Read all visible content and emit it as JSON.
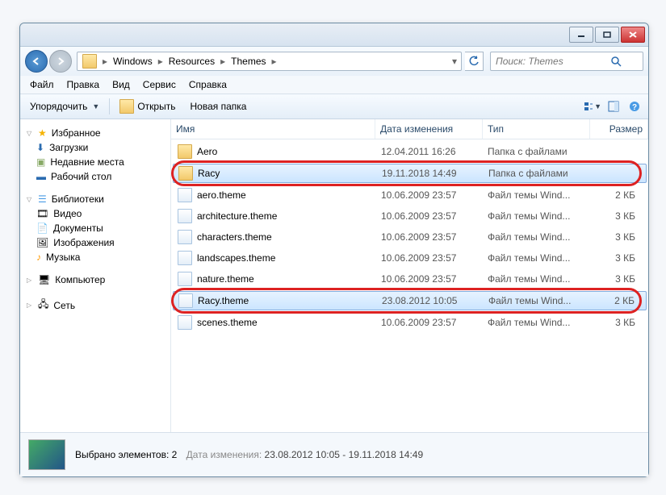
{
  "breadcrumb": {
    "p1": "Windows",
    "p2": "Resources",
    "p3": "Themes"
  },
  "search": {
    "placeholder": "Поиск: Themes"
  },
  "menu": {
    "file": "Файл",
    "edit": "Правка",
    "view": "Вид",
    "tools": "Сервис",
    "help": "Справка"
  },
  "toolbar": {
    "organize": "Упорядочить",
    "open": "Открыть",
    "newfolder": "Новая папка"
  },
  "columns": {
    "name": "Имя",
    "date": "Дата изменения",
    "type": "Тип",
    "size": "Размер"
  },
  "sidebar": {
    "favorites": {
      "label": "Избранное",
      "items": {
        "downloads": "Загрузки",
        "recent": "Недавние места",
        "desktop": "Рабочий стол"
      }
    },
    "libraries": {
      "label": "Библиотеки",
      "items": {
        "video": "Видео",
        "documents": "Документы",
        "images": "Изображения",
        "music": "Музыка"
      }
    },
    "computer": {
      "label": "Компьютер"
    },
    "network": {
      "label": "Сеть"
    }
  },
  "files": [
    {
      "name": "Aero",
      "date": "12.04.2011 16:26",
      "type": "Папка с файлами",
      "size": "",
      "icon": "folder",
      "sel": false,
      "hl": false
    },
    {
      "name": "Racy",
      "date": "19.11.2018 14:49",
      "type": "Папка с файлами",
      "size": "",
      "icon": "folder",
      "sel": true,
      "hl": true
    },
    {
      "name": "aero.theme",
      "date": "10.06.2009 23:57",
      "type": "Файл темы Wind...",
      "size": "2 КБ",
      "icon": "file",
      "sel": false,
      "hl": false
    },
    {
      "name": "architecture.theme",
      "date": "10.06.2009 23:57",
      "type": "Файл темы Wind...",
      "size": "3 КБ",
      "icon": "file",
      "sel": false,
      "hl": false
    },
    {
      "name": "characters.theme",
      "date": "10.06.2009 23:57",
      "type": "Файл темы Wind...",
      "size": "3 КБ",
      "icon": "file",
      "sel": false,
      "hl": false
    },
    {
      "name": "landscapes.theme",
      "date": "10.06.2009 23:57",
      "type": "Файл темы Wind...",
      "size": "3 КБ",
      "icon": "file",
      "sel": false,
      "hl": false
    },
    {
      "name": "nature.theme",
      "date": "10.06.2009 23:57",
      "type": "Файл темы Wind...",
      "size": "3 КБ",
      "icon": "file",
      "sel": false,
      "hl": false
    },
    {
      "name": "Racy.theme",
      "date": "23.08.2012 10:05",
      "type": "Файл темы Wind...",
      "size": "2 КБ",
      "icon": "file",
      "sel": true,
      "hl": true
    },
    {
      "name": "scenes.theme",
      "date": "10.06.2009 23:57",
      "type": "Файл темы Wind...",
      "size": "3 КБ",
      "icon": "file",
      "sel": false,
      "hl": false
    }
  ],
  "status": {
    "label": "Выбрано элементов: 2",
    "datelabel": "Дата изменения:",
    "dateval": "23.08.2012 10:05 - 19.11.2018 14:49"
  }
}
